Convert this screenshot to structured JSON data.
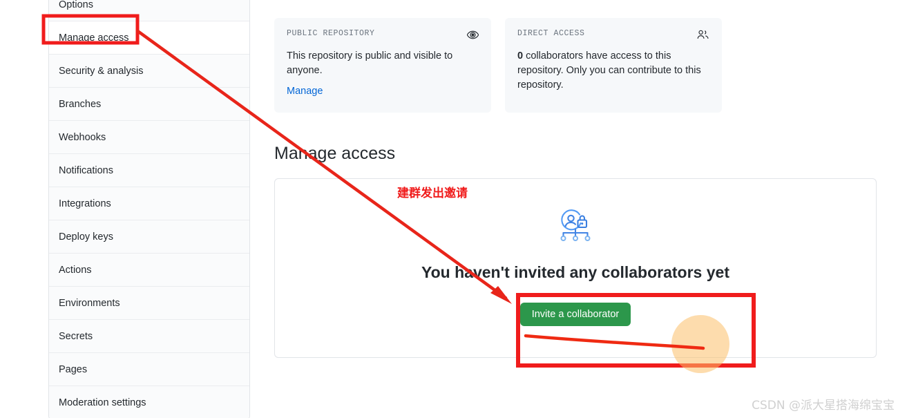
{
  "sidebar": {
    "items": [
      {
        "label": "Options",
        "selected": false
      },
      {
        "label": "Manage access",
        "selected": true
      },
      {
        "label": "Security & analysis",
        "selected": false
      },
      {
        "label": "Branches",
        "selected": false
      },
      {
        "label": "Webhooks",
        "selected": false
      },
      {
        "label": "Notifications",
        "selected": false
      },
      {
        "label": "Integrations",
        "selected": false
      },
      {
        "label": "Deploy keys",
        "selected": false
      },
      {
        "label": "Actions",
        "selected": false
      },
      {
        "label": "Environments",
        "selected": false
      },
      {
        "label": "Secrets",
        "selected": false
      },
      {
        "label": "Pages",
        "selected": false
      },
      {
        "label": "Moderation settings",
        "selected": false
      }
    ]
  },
  "cards": {
    "public": {
      "kicker": "PUBLIC REPOSITORY",
      "icon": "eye-icon",
      "body": "This repository is public and visible to anyone.",
      "link": "Manage"
    },
    "direct": {
      "kicker": "DIRECT ACCESS",
      "icon": "people-icon",
      "count": "0",
      "body": " collaborators have access to this repository. Only you can contribute to this repository."
    }
  },
  "main": {
    "title": "Manage access",
    "empty_heading": "You haven't invited any collaborators yet",
    "invite_button": "Invite a collaborator",
    "illustration": "person-lock-org-chart-icon"
  },
  "annotations": {
    "note_cn": "建群发出邀请",
    "highlight_color": "#f01c1c",
    "accent_green": "#2c974b",
    "link_blue": "#0366d6"
  },
  "watermark": {
    "text": "CSDN @派大星搭海绵宝宝"
  }
}
